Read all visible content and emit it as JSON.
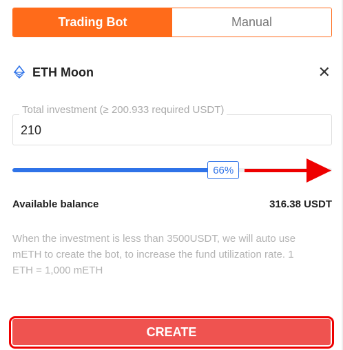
{
  "tabs": [
    {
      "label": "Trading Bot",
      "active": true
    },
    {
      "label": "Manual",
      "active": false
    }
  ],
  "bot": {
    "icon": "ethereum-icon",
    "name": "ETH Moon",
    "close_icon": "close-icon",
    "close_glyph": "✕"
  },
  "investment": {
    "label": "Total investment (≥ 200.933 required USDT)",
    "value": "210"
  },
  "slider": {
    "percent": 66,
    "label": "66%"
  },
  "balance": {
    "label": "Available balance",
    "value": "316.38 USDT"
  },
  "note": "When the investment is less than 3500USDT, we will auto use mETH to create the bot, to increase the fund utilization rate. 1 ETH = 1,000 mETH",
  "create_label": "CREATE",
  "colors": {
    "accent": "#ff6b1a",
    "slider": "#2f73e8",
    "create": "#ef5350",
    "highlight": "#ee0000"
  }
}
